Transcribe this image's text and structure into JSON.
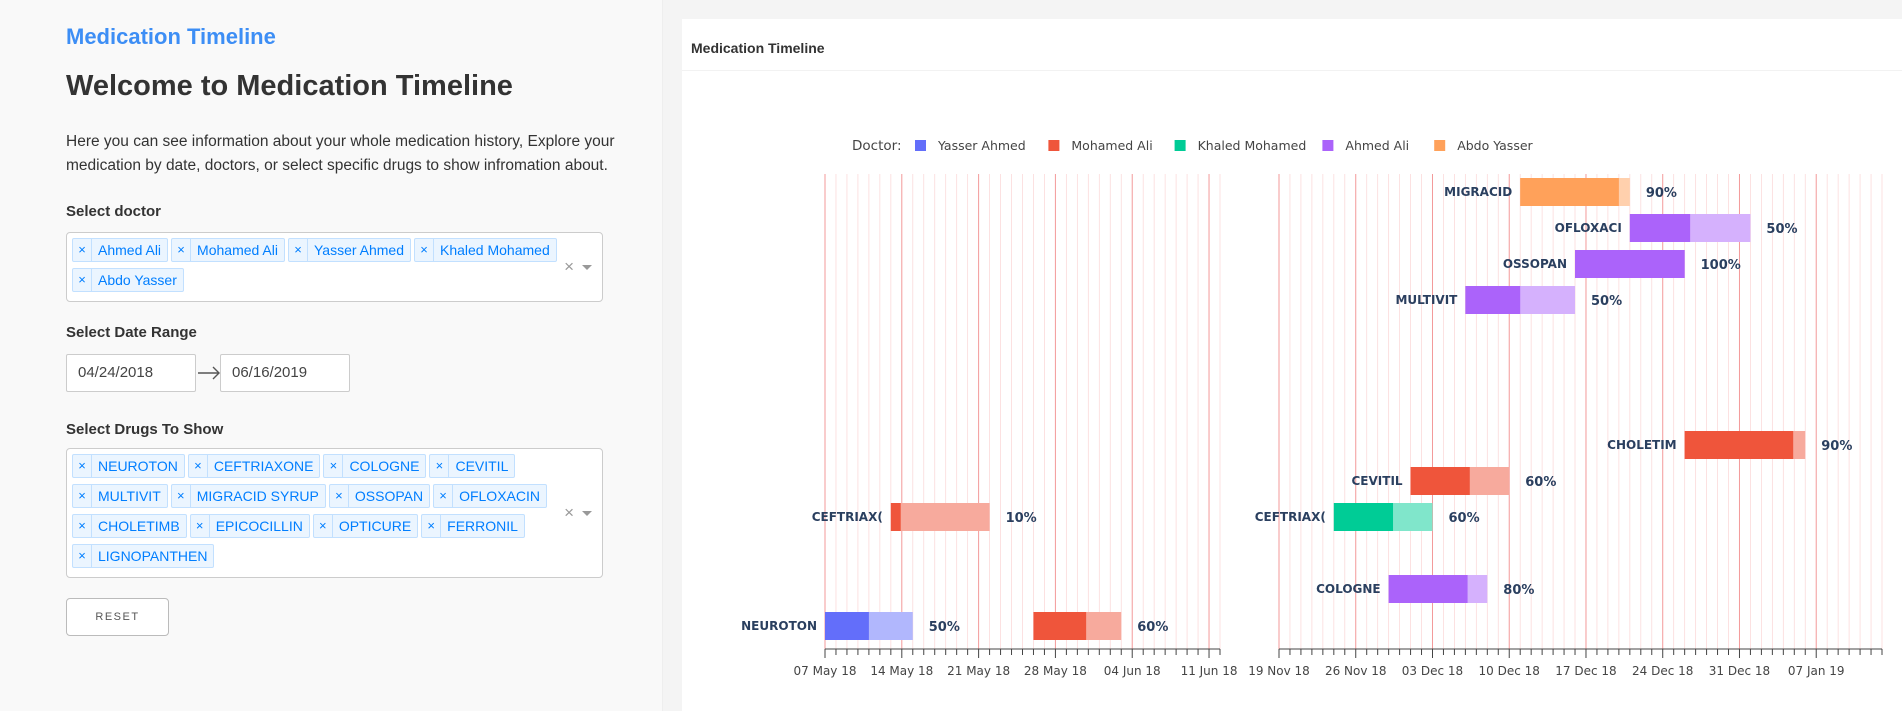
{
  "left": {
    "app_title": "Medication Timeline",
    "welcome": "Welcome to Medication Timeline",
    "intro": "Here you can see information about your whole medication history, Explore your medication by date, doctors, or select specific drugs to show infromation about.",
    "doctor_label": "Select doctor",
    "doctors": [
      "Ahmed Ali",
      "Mohamed Ali",
      "Yasser Ahmed",
      "Khaled Mohamed",
      "Abdo Yasser"
    ],
    "date_label": "Select Date Range",
    "start_date": "04/24/2018",
    "end_date": "06/16/2019",
    "drugs_label": "Select Drugs To Show",
    "drugs": [
      "NEUROTON",
      "CEFTRIAXONE",
      "COLOGNE",
      "CEVITIL",
      "MULTIVIT",
      "MIGRACID SYRUP",
      "OSSOPAN",
      "OFLOXACIN",
      "CHOLETIMB",
      "EPICOCILLIN",
      "OPTICURE",
      "FERRONIL",
      "LIGNOPANTHEN"
    ],
    "clear_glyph": "×",
    "chip_remove_glyph": "×",
    "reset_label": "RESET"
  },
  "chart": {
    "title": "Medication Timeline",
    "legend_title": "Doctor:"
  },
  "chart_data": {
    "type": "bar",
    "orientation": "horizontal-timeline",
    "legend": [
      {
        "name": "Yasser Ahmed",
        "color": "#636efa"
      },
      {
        "name": "Mohamed Ali",
        "color": "#ef553b"
      },
      {
        "name": "Khaled Mohamed",
        "color": "#00cc96"
      },
      {
        "name": "Ahmed Ali",
        "color": "#ab63fa"
      },
      {
        "name": "Abdo Yasser",
        "color": "#ffa15a"
      }
    ],
    "legend_placement": "top",
    "panels": [
      {
        "xrange": [
          "2018-05-07",
          "2018-06-12"
        ],
        "ticks": [
          "07 May 18",
          "14 May 18",
          "21 May 18",
          "28 May 18",
          "04 Jun 18",
          "11 Jun 18"
        ],
        "bars": [
          {
            "drug": "CEFTRIAXONE",
            "label": "CEFTRIAX(",
            "doctor": "Mohamed Ali",
            "start": "2018-05-13",
            "end": "2018-05-22",
            "percent": "10%"
          },
          {
            "drug": "NEUROTON",
            "label": "NEUROTON",
            "doctor": "Yasser Ahmed",
            "start": "2018-05-07",
            "end": "2018-05-15",
            "percent": "50%"
          },
          {
            "drug": "NEUROTON",
            "label": "",
            "doctor": "Mohamed Ali",
            "start": "2018-05-26",
            "end": "2018-06-03",
            "percent": "60%"
          }
        ]
      },
      {
        "xrange": [
          "2018-11-19",
          "2019-01-13"
        ],
        "ticks": [
          "19 Nov 18",
          "26 Nov 18",
          "03 Dec 18",
          "10 Dec 18",
          "17 Dec 18",
          "24 Dec 18",
          "31 Dec 18",
          "07 Jan 19"
        ],
        "bars": [
          {
            "drug": "MIGRACID SYRUP",
            "label": "MIGRACID",
            "doctor": "Abdo Yasser",
            "start": "2018-12-11",
            "end": "2018-12-21",
            "percent": "90%"
          },
          {
            "drug": "OFLOXACIN",
            "label": "OFLOXACI",
            "doctor": "Ahmed Ali",
            "start": "2018-12-21",
            "end": "2019-01-01",
            "percent": "50%"
          },
          {
            "drug": "OSSOPAN",
            "label": "OSSOPAN",
            "doctor": "Ahmed Ali",
            "start": "2018-12-16",
            "end": "2018-12-26",
            "percent": "100%"
          },
          {
            "drug": "MULTIVIT",
            "label": "MULTIVIT",
            "doctor": "Ahmed Ali",
            "start": "2018-12-06",
            "end": "2018-12-16",
            "percent": "50%"
          },
          {
            "drug": "CHOLETIMB",
            "label": "CHOLETIM",
            "doctor": "Mohamed Ali",
            "start": "2018-12-26",
            "end": "2019-01-06",
            "percent": "90%"
          },
          {
            "drug": "CEVITIL",
            "label": "CEVITIL",
            "doctor": "Mohamed Ali",
            "start": "2018-12-01",
            "end": "2018-12-10",
            "percent": "60%"
          },
          {
            "drug": "CEFTRIAXONE",
            "label": "CEFTRIAX(",
            "doctor": "Khaled Mohamed",
            "start": "2018-11-24",
            "end": "2018-12-03",
            "percent": "60%"
          },
          {
            "drug": "COLOGNE",
            "label": "COLOGNE",
            "doctor": "Ahmed Ali",
            "start": "2018-11-29",
            "end": "2018-12-08",
            "percent": "80%"
          }
        ]
      }
    ],
    "grid": true
  }
}
